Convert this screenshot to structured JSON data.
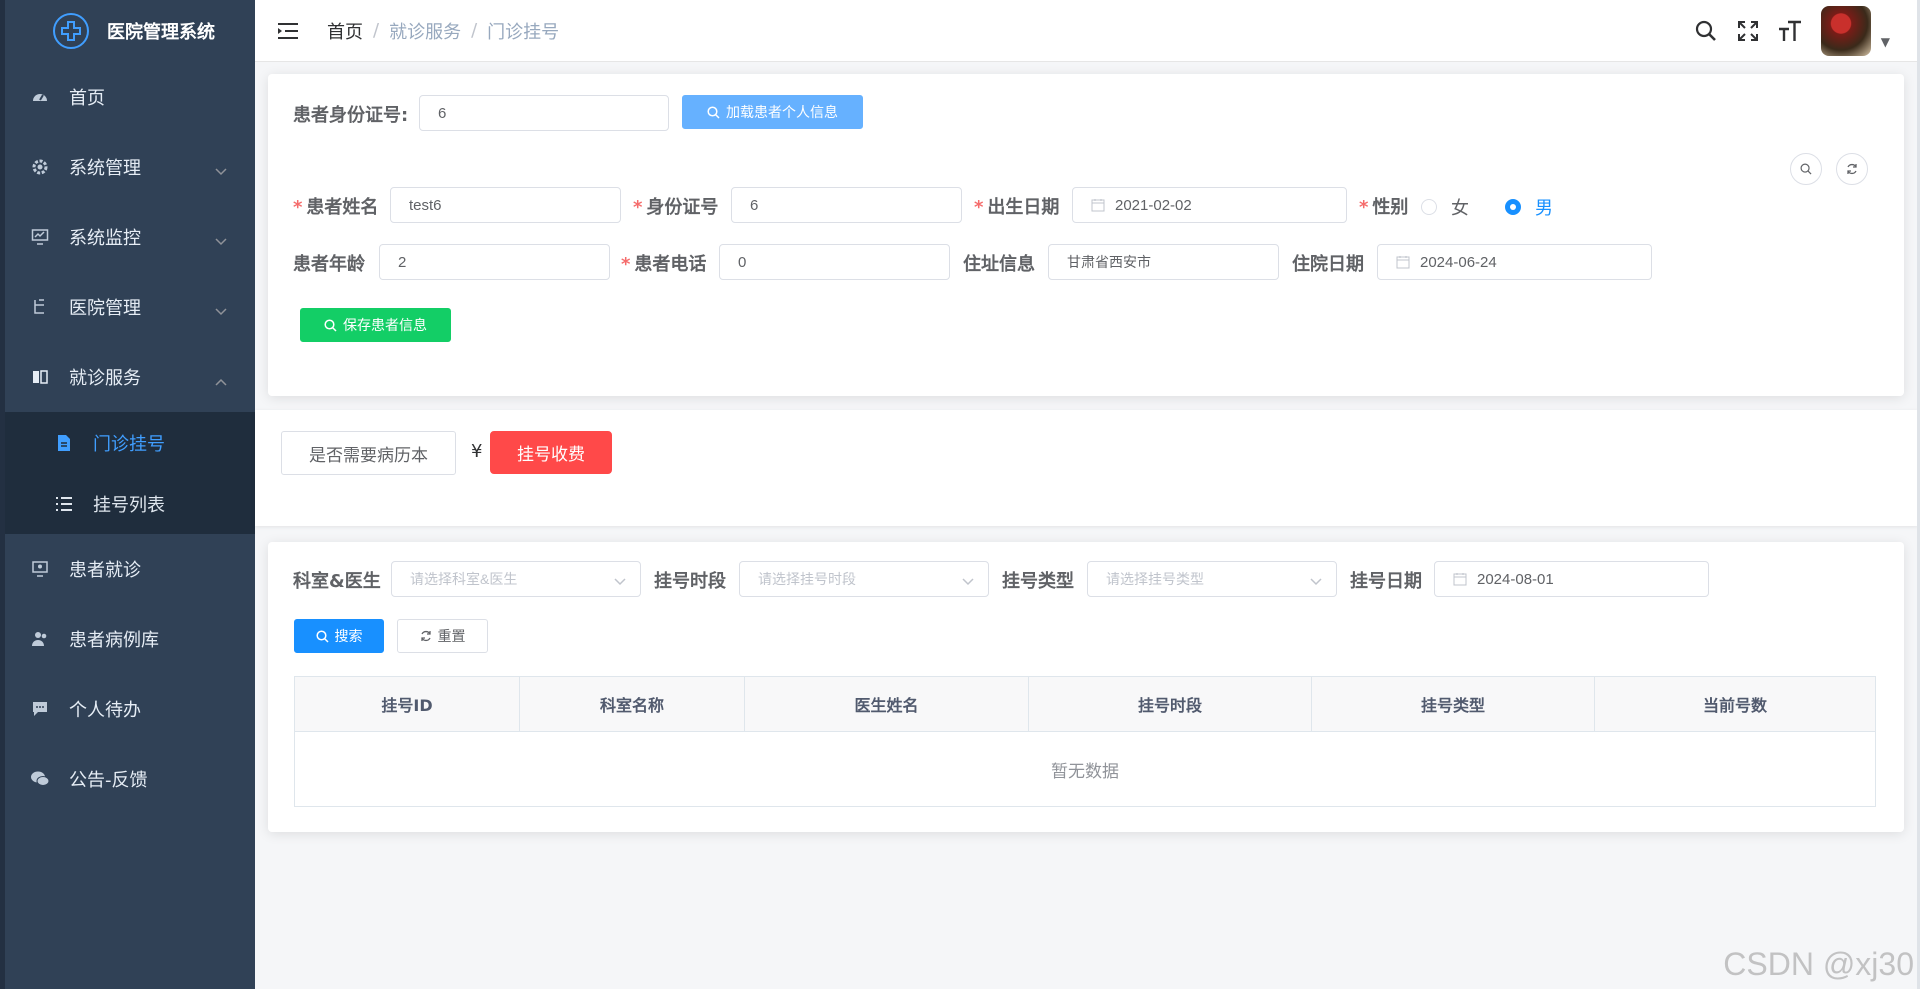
{
  "sidebar": {
    "logo_text": "医院管理系统",
    "items": [
      {
        "label": "首页"
      },
      {
        "label": "系统管理"
      },
      {
        "label": "系统监控"
      },
      {
        "label": "医院管理"
      },
      {
        "label": "就诊服务"
      },
      {
        "label": "门诊挂号"
      },
      {
        "label": "挂号列表"
      },
      {
        "label": "患者就诊"
      },
      {
        "label": "患者病例库"
      },
      {
        "label": "个人待办"
      },
      {
        "label": "公告-反馈"
      }
    ]
  },
  "header": {
    "breadcrumb": [
      "首页",
      "就诊服务",
      "门诊挂号"
    ],
    "separator": "/"
  },
  "patient_lookup": {
    "label": "患者身份证号:",
    "value": "6",
    "load_button": "加载患者个人信息"
  },
  "patient_form": {
    "name_label": "患者姓名",
    "name_value": "test6",
    "id_label": "身份证号",
    "id_value": "6",
    "birth_label": "出生日期",
    "birth_value": "2021-02-02",
    "gender_label": "性别",
    "gender_female": "女",
    "gender_male": "男",
    "gender_selected": "男",
    "age_label": "患者年龄",
    "age_value": "2",
    "phone_label": "患者电话",
    "phone_value": "0",
    "address_label": "住址信息",
    "address_value": "甘肃省西安市",
    "admission_label": "住院日期",
    "admission_value": "2024-06-24",
    "save_button": "保存患者信息",
    "required_mark": "*"
  },
  "fee": {
    "record_button": "是否需要病历本",
    "currency": "¥",
    "pay_button": "挂号收费"
  },
  "search": {
    "dept_label": "科室&医生",
    "dept_placeholder": "请选择科室&医生",
    "period_label": "挂号时段",
    "period_placeholder": "请选择挂号时段",
    "type_label": "挂号类型",
    "type_placeholder": "请选择挂号类型",
    "date_label": "挂号日期",
    "date_value": "2024-08-01",
    "search_button": "搜索",
    "reset_button": "重置"
  },
  "table": {
    "columns": [
      "挂号ID",
      "科室名称",
      "医生姓名",
      "挂号时段",
      "挂号类型",
      "当前号数"
    ],
    "empty_text": "暂无数据"
  },
  "watermark": "CSDN @xj30",
  "colors": {
    "sidebar_bg": "#304156",
    "primary": "#1890ff",
    "success": "#13ce66",
    "danger": "#ff4949"
  }
}
